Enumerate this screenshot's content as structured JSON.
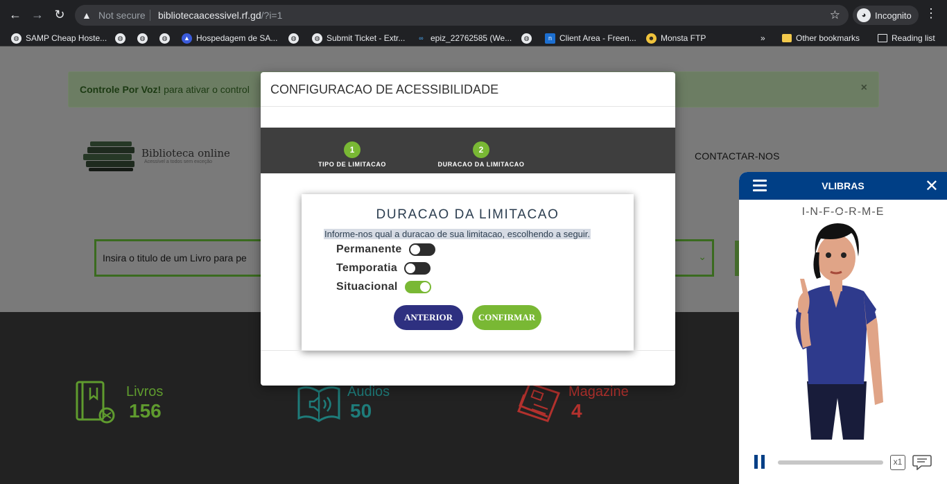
{
  "browser": {
    "security_label": "Not secure",
    "url_host": "bibliotecaacessivel.rf.gd",
    "url_path": "/?i=1",
    "incognito_label": "Incognito",
    "bookmarks": [
      "SAMP Cheap Hoste...",
      "Hospedagem de SA...",
      "Submit Ticket - Extr...",
      "epiz_22762585 (We...",
      "Client Area - Freen...",
      "Monsta FTP"
    ],
    "overflow_label": "»",
    "other_bookmarks": "Other bookmarks",
    "reading_list": "Reading list"
  },
  "page": {
    "alert": {
      "bold": "Controle Por Voz!",
      "text": " para ativar o control",
      "close": "×"
    },
    "logo": {
      "title": "Biblioteca online",
      "subtitle": "Acessível a todos sem exceção"
    },
    "nav_contact": "CONTACTAR-NOS",
    "search_placeholder": "Insira o titulo de um Livro para pe",
    "stats": [
      {
        "label": "Livros",
        "value": "156",
        "color": "#5f9b2e"
      },
      {
        "label": "Audios",
        "value": "50",
        "color": "#1e7c7a"
      },
      {
        "label": "Magazine",
        "value": "4",
        "color": "#b2312d"
      }
    ]
  },
  "modal": {
    "title": "CONFIGURACAO DE ACESSIBILIDADE",
    "steps": [
      {
        "number": "1",
        "label": "TIPO DE LIMITACAO"
      },
      {
        "number": "2",
        "label": "DURACAO DA LIMITACAO"
      }
    ],
    "card": {
      "title": "DURACAO DA LIMITACAO",
      "description": "Informe-nos qual a duracao de sua limitacao, escolhendo a seguir.",
      "options": [
        {
          "label": "Permanente",
          "checked": false
        },
        {
          "label": "Temporatia",
          "checked": false
        },
        {
          "label": "Situacional",
          "checked": true
        }
      ],
      "prev_label": "ANTERIOR",
      "confirm_label": "CONFIRMAR"
    }
  },
  "vlibras": {
    "title": "VLIBRAS",
    "word": "I-N-F-O-R-M-E",
    "speed": "x1",
    "progress": 0
  }
}
